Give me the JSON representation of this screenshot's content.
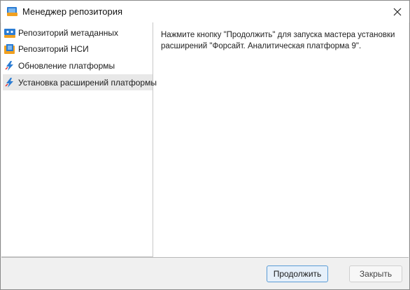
{
  "window": {
    "title": "Менеджер репозитория",
    "icon": "repository-manager-icon"
  },
  "sidebar": {
    "items": [
      {
        "label": "Репозиторий метаданных",
        "icon": "metadata-repository-icon",
        "selected": false
      },
      {
        "label": "Репозиторий НСИ",
        "icon": "nsi-repository-icon",
        "selected": false
      },
      {
        "label": "Обновление платформы",
        "icon": "platform-update-icon",
        "selected": false
      },
      {
        "label": "Установка расширений платформы",
        "icon": "extension-install-icon",
        "selected": true
      }
    ]
  },
  "main": {
    "message": "Нажмите кнопку \"Продолжить\" для запуска мастера установки расширений \"Форсайт. Аналитическая платформа 9\"."
  },
  "footer": {
    "continue_label": "Продолжить",
    "close_label": "Закрыть"
  },
  "colors": {
    "accent_border": "#5a9bd5",
    "selection_bg": "#e8e8e8",
    "icon_blue": "#2b7cd3",
    "icon_orange": "#f0a020"
  }
}
